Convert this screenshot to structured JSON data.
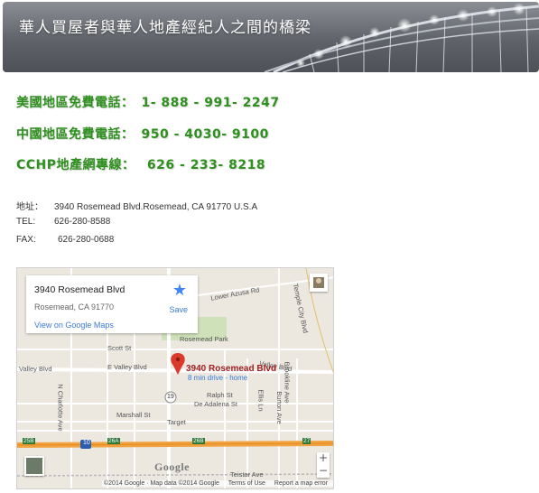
{
  "banner": {
    "slogan": "華人買屋者與華人地產經紀人之間的橋梁"
  },
  "phones": [
    {
      "label": "美國地區免費電話：",
      "number": "1- 888 - 991- 2247"
    },
    {
      "label": "中國地區免費電話：",
      "number": "950 - 4030- 9100"
    },
    {
      "label": "CCHP地產網專線：",
      "number": " 626 - 233- 8218"
    }
  ],
  "contact": {
    "address_label": "地址：",
    "address": "3940 Rosemead Blvd.Rosemead, CA 91770 U.S.A",
    "tel_label": "TEL:",
    "tel": "626-280-8588",
    "fax_label": "FAX:",
    "fax": "626-280-0688"
  },
  "map": {
    "card": {
      "name": "3940 Rosemead Blvd",
      "address": "Rosemead, CA 91770",
      "link": "View on Google Maps",
      "save": "Save"
    },
    "pin": {
      "title": "3940 Rosemead Blvd",
      "subtitle": "8 min drive - home"
    },
    "labels": {
      "lower_azusa": "Lower Azusa Rd",
      "temple_city": "Temple City Blvd",
      "rosemead_park": "Rosemead Park",
      "scott_st": "Scott St",
      "valley_blvd_w": "Valley Blvd",
      "e_valley_blvd": "E Valley Blvd",
      "valley_blvd_e": "Valley Blvd",
      "ralph_st": "Ralph St",
      "de_adalena": "De Adalena St",
      "marshall_st": "Marshall St",
      "target": "Target",
      "charlotte": "N Charlotte Ave",
      "ellis": "Ellis Ln",
      "burton": "Burton Ave",
      "brookline": "Brookline Ave",
      "teistar": "Teistar Ave",
      "rt19": "19",
      "i10": "10",
      "exit25b": "25B",
      "exit26a": "26A",
      "exit26b": "26B",
      "exit27": "27"
    },
    "logo": "Google",
    "footer": [
      "©2014 Google · Map data ©2014 Google",
      "Terms of Use",
      "Report a map error"
    ],
    "zoom_in": "+",
    "zoom_out": "−"
  }
}
